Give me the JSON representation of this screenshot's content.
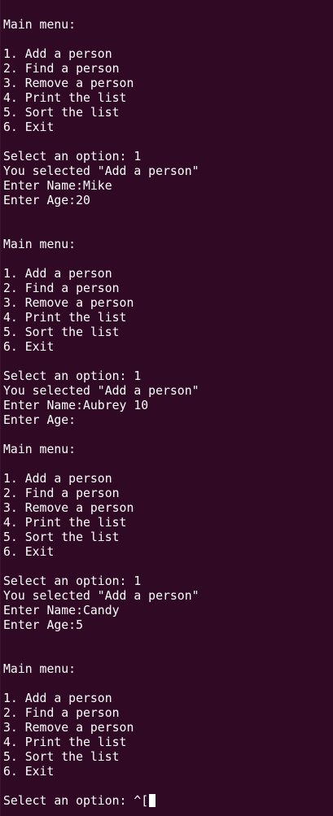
{
  "terminal": {
    "lines": [
      "Main menu:",
      "",
      "1. Add a person",
      "2. Find a person",
      "3. Remove a person",
      "4. Print the list",
      "5. Sort the list",
      "6. Exit",
      "",
      "Select an option: 1",
      "You selected \"Add a person\"",
      "Enter Name:Mike",
      "Enter Age:20",
      "",
      "",
      "Main menu:",
      "",
      "1. Add a person",
      "2. Find a person",
      "3. Remove a person",
      "4. Print the list",
      "5. Sort the list",
      "6. Exit",
      "",
      "Select an option: 1",
      "You selected \"Add a person\"",
      "Enter Name:Aubrey 10",
      "Enter Age:",
      "",
      "Main menu:",
      "",
      "1. Add a person",
      "2. Find a person",
      "3. Remove a person",
      "4. Print the list",
      "5. Sort the list",
      "6. Exit",
      "",
      "Select an option: 1",
      "You selected \"Add a person\"",
      "Enter Name:Candy",
      "Enter Age:5",
      "",
      "",
      "Main menu:",
      "",
      "1. Add a person",
      "2. Find a person",
      "3. Remove a person",
      "4. Print the list",
      "5. Sort the list",
      "6. Exit",
      ""
    ],
    "prompt_line": "Select an option: ^[",
    "colors": {
      "background": "#300a24",
      "foreground": "#ffffff"
    }
  }
}
